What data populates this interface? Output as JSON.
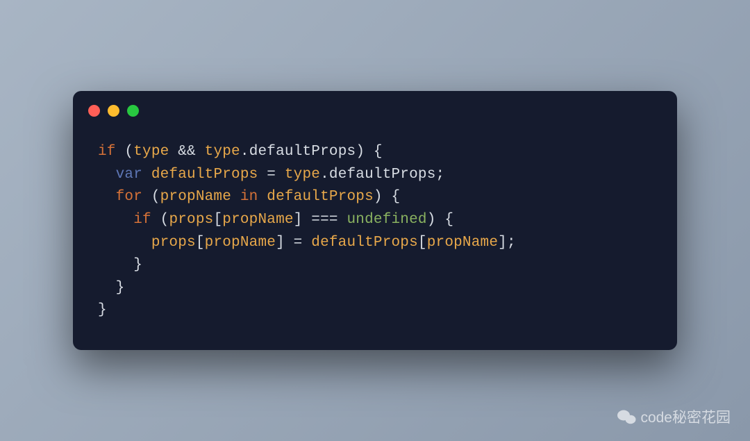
{
  "colors": {
    "bg_window": "#151b2e",
    "traffic_red": "#ff5f57",
    "traffic_yellow": "#febc2e",
    "traffic_green": "#28c840",
    "keyword": "#d67238",
    "variable_decl": "#5d76b5",
    "identifier": "#e8a84a",
    "default_text": "#d8dde4",
    "constant": "#8ab260"
  },
  "code": {
    "line1": {
      "t0": "if",
      "t1": " (",
      "t2": "type",
      "t3": " && ",
      "t4": "type",
      "t5": ".",
      "t6": "defaultProps",
      "t7": ") {"
    },
    "line2": {
      "indent": "  ",
      "t0": "var",
      "t1": " ",
      "t2": "defaultProps",
      "t3": " = ",
      "t4": "type",
      "t5": ".",
      "t6": "defaultProps",
      "t7": ";"
    },
    "line3": {
      "indent": "  ",
      "t0": "for",
      "t1": " (",
      "t2": "propName",
      "t3": " ",
      "t4": "in",
      "t5": " ",
      "t6": "defaultProps",
      "t7": ") {"
    },
    "line4": {
      "indent": "    ",
      "t0": "if",
      "t1": " (",
      "t2": "props",
      "t3": "[",
      "t4": "propName",
      "t5": "] === ",
      "t6": "undefined",
      "t7": ") {"
    },
    "line5": {
      "indent": "      ",
      "t0": "props",
      "t1": "[",
      "t2": "propName",
      "t3": "] = ",
      "t4": "defaultProps",
      "t5": "[",
      "t6": "propName",
      "t7": "];"
    },
    "line6": {
      "indent": "    ",
      "t0": "}"
    },
    "line7": {
      "indent": "  ",
      "t0": "}"
    },
    "line8": {
      "t0": "}"
    }
  },
  "watermark": {
    "label": "code秘密花园",
    "icon": "wechat-icon"
  }
}
